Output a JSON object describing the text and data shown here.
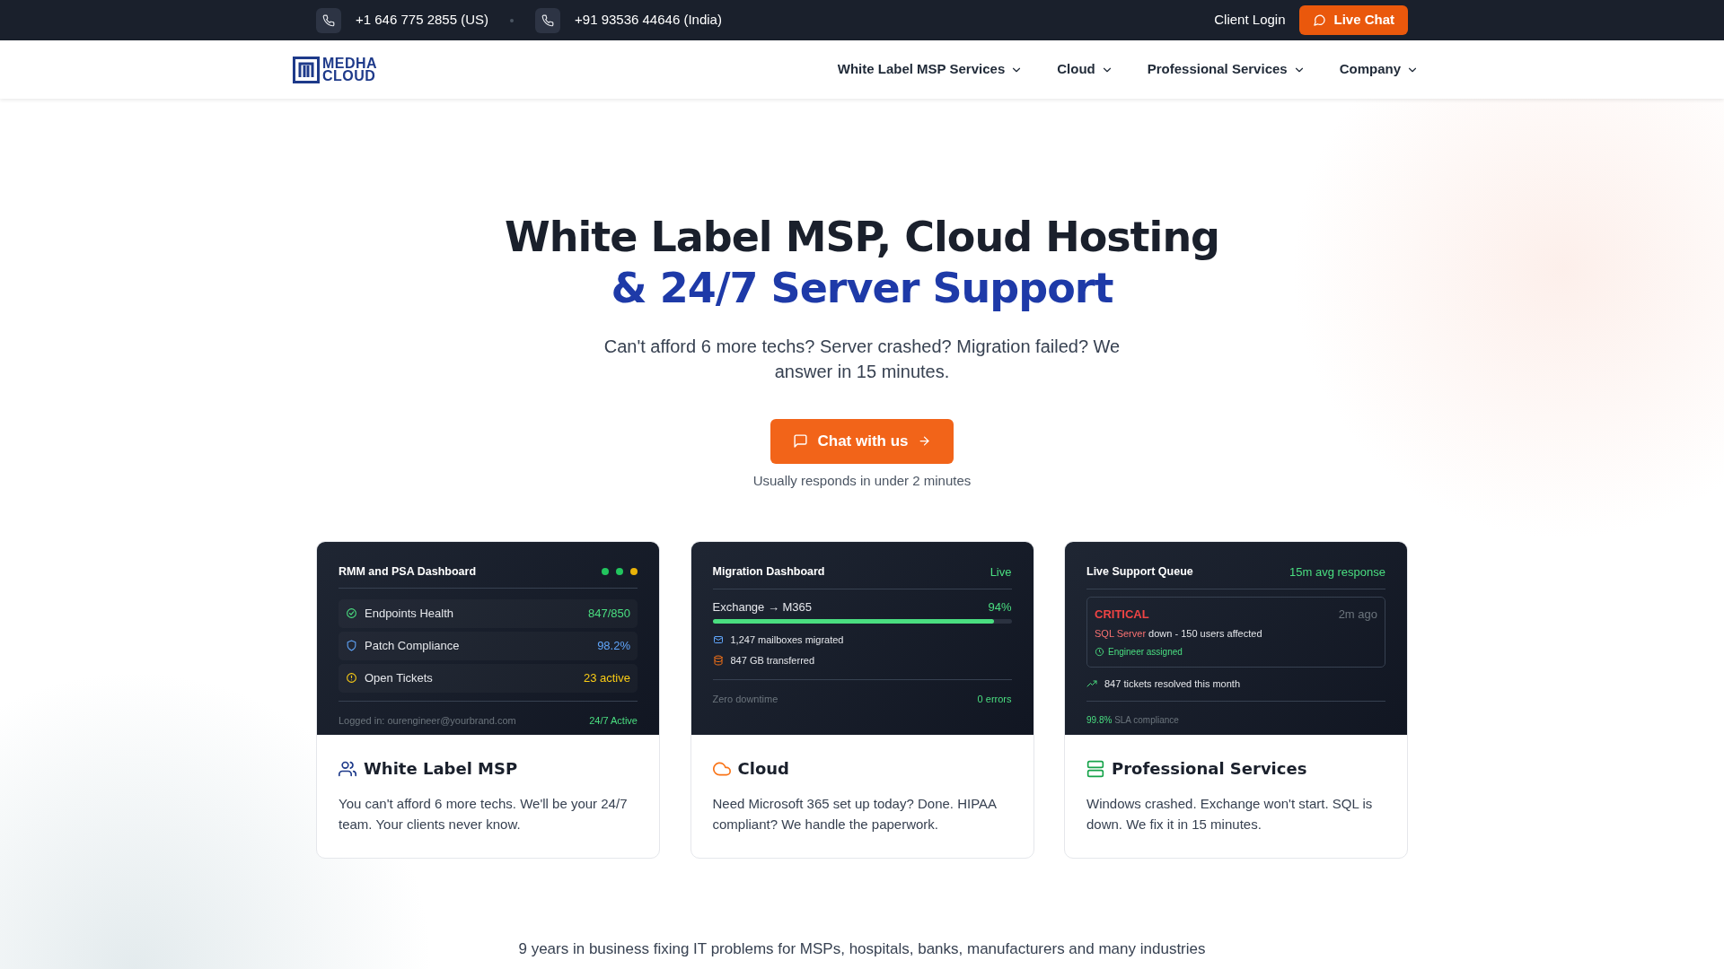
{
  "topbar": {
    "phones": [
      {
        "text": "+1 646 775 2855 (US)"
      },
      {
        "text": "+91 93536 44646 (India)"
      }
    ],
    "client_login": "Client Login",
    "live_chat": "Live Chat"
  },
  "navbar": {
    "logo": [
      "MEDHA",
      "CLOUD"
    ],
    "menu": [
      {
        "label": "White Label MSP Services"
      },
      {
        "label": "Cloud"
      },
      {
        "label": "Professional Services"
      },
      {
        "label": "Company"
      }
    ]
  },
  "hero": {
    "title_line1": "White Label MSP, Cloud Hosting",
    "title_line2": "& 24/7 Server Support",
    "subtitle": "Can't afford 6 more techs? Server crashed? Migration failed? We answer in 15 minutes.",
    "cta": "Chat with us",
    "note": "Usually responds in under 2 minutes"
  },
  "cards": [
    {
      "kind": "rmm",
      "panel": {
        "title": "RMM and PSA Dashboard",
        "dots": [
          {
            "color": "#22c55e"
          },
          {
            "color": "#22c55e"
          },
          {
            "color": "#eab308"
          }
        ],
        "rows": [
          {
            "label": "Endpoints Health",
            "value": "847/850",
            "color": "#4ade80"
          },
          {
            "label": "Patch Compliance",
            "value": "98.2%",
            "color": "#60a5fa"
          },
          {
            "label": "Open Tickets",
            "value": "23 active",
            "color": "#facc15"
          }
        ],
        "footer_left": "Logged in: ourengineer@yourbrand.com",
        "footer_right": "24/7 Active"
      },
      "title": "White Label MSP",
      "text": "You can't afford 6 more techs. We'll be your 24/7 team. Your clients never know."
    },
    {
      "kind": "migration",
      "panel": {
        "title": "Migration Dashboard",
        "status": "Live",
        "progress": {
          "label": "Exchange → M365",
          "value": "94%",
          "level": 0.94
        },
        "items": [
          {
            "text": "1,247 mailboxes migrated"
          },
          {
            "text": "847 GB transferred"
          }
        ],
        "footer_left": "Zero downtime",
        "footer_right": "0 errors"
      },
      "title": "Cloud",
      "text": "Need Microsoft 365 set up today? Done. HIPAA compliant? We handle the paperwork."
    },
    {
      "kind": "queue",
      "panel": {
        "title": "Live Support Queue",
        "status": "15m avg response",
        "alert": {
          "severity": "CRITICAL",
          "time": "2m ago",
          "source": "SQL Server",
          "message": "down - 150 users affected",
          "assigned": "Engineer assigned"
        },
        "stat": "847 tickets resolved this month",
        "footer_value": "99.8%",
        "footer_label": "SLA compliance"
      },
      "title": "Professional Services",
      "text": "Windows crashed. Exchange won't start. SQL is down. We fix it in 15 minutes."
    }
  ],
  "tagline": "9 years in business fixing IT problems for MSPs, hospitals, banks, manufacturers and many industries"
}
